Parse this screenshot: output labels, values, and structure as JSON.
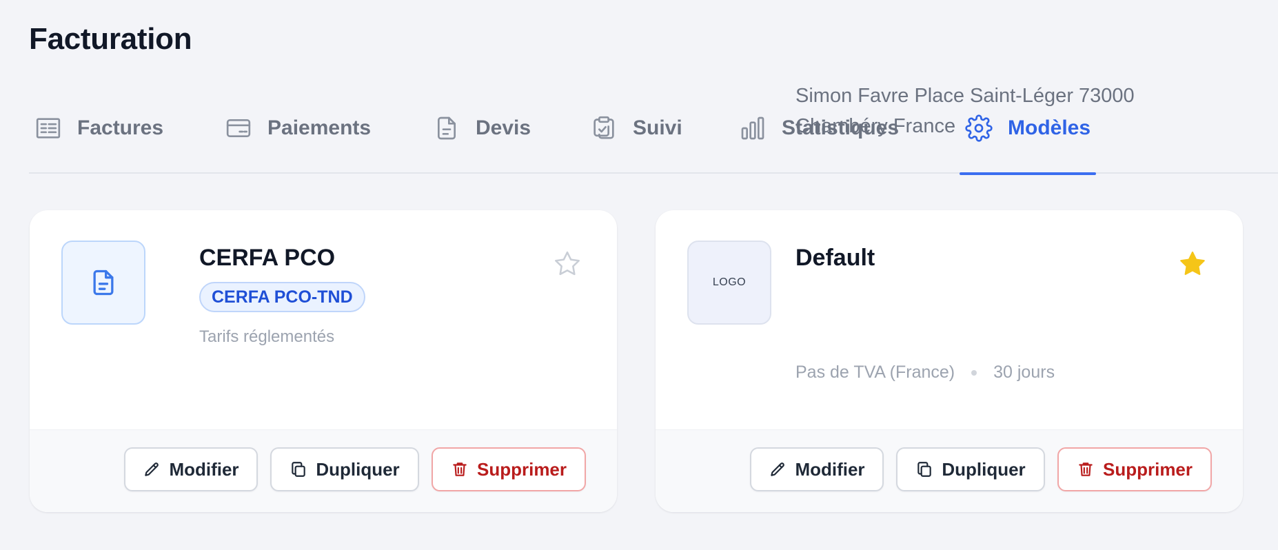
{
  "header": {
    "title": "Facturation"
  },
  "tabs": [
    {
      "label": "Factures",
      "icon": "invoice-list-icon"
    },
    {
      "label": "Paiements",
      "icon": "credit-card-icon"
    },
    {
      "label": "Devis",
      "icon": "document-icon"
    },
    {
      "label": "Suivi",
      "icon": "clipboard-check-icon"
    },
    {
      "label": "Statistiques",
      "icon": "bar-chart-icon"
    },
    {
      "label": "Modèles",
      "icon": "gear-icon",
      "active": true
    }
  ],
  "colors": {
    "accent": "#2f63e6",
    "danger": "#b91c1c",
    "star_active": "#f5c518"
  },
  "templates": [
    {
      "title": "CERFA PCO",
      "badge": "CERFA PCO-TND",
      "subtitle": "Tarifs réglementés",
      "favorite": false,
      "thumb_icon": "document-icon",
      "actions": {
        "edit": "Modifier",
        "duplicate": "Dupliquer",
        "delete": "Supprimer"
      }
    },
    {
      "title": "Default",
      "logo_text": "LOGO",
      "address": "Simon Favre Place Saint-Léger 73000 Chambéry France",
      "vat": "Pas de TVA (France)",
      "payment_terms": "30 jours",
      "favorite": true,
      "actions": {
        "edit": "Modifier",
        "duplicate": "Dupliquer",
        "delete": "Supprimer"
      }
    }
  ]
}
